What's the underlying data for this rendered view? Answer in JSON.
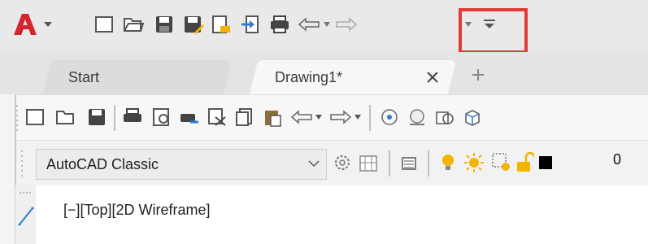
{
  "tabs": [
    {
      "label": "Start"
    },
    {
      "label": "Drawing1*"
    }
  ],
  "workspace": {
    "selected": "AutoCAD Classic"
  },
  "layer": {
    "current": "0"
  },
  "viewport": {
    "label": "[−][Top][2D Wireframe]"
  },
  "icons": {
    "app_logo": "autocad-a-logo",
    "qat": [
      "new-icon",
      "open-icon",
      "save-icon",
      "save-as-icon",
      "open-from-web-icon",
      "share-icon",
      "plot-icon",
      "undo-icon",
      "redo-icon",
      "customize-qat-icon"
    ],
    "tab_close": "close-icon",
    "tab_add": "plus-icon"
  },
  "colors": {
    "highlight": "#e23a3a",
    "app_logo": "#d5262d",
    "accent_blue": "#2f7bd6",
    "sun_yellow": "#f2b400"
  }
}
